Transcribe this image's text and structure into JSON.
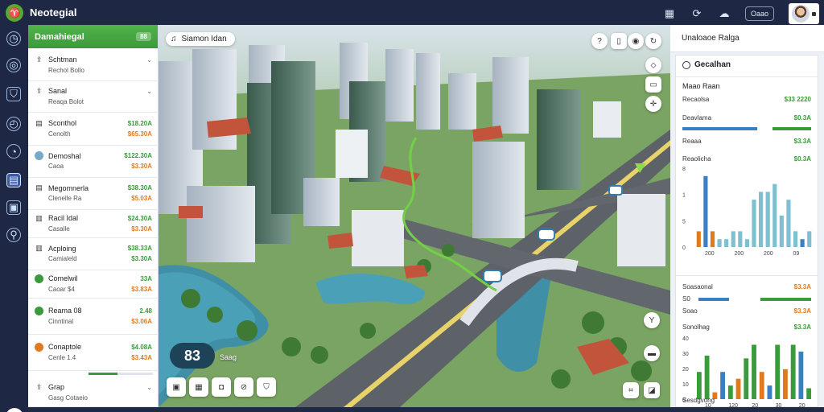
{
  "app": {
    "title": "Neotegial",
    "logo_glyph": "♈"
  },
  "topbar": {
    "icons": [
      "clipboard-icon",
      "refresh-icon",
      "cloud-icon"
    ],
    "pill_label": "Oaao"
  },
  "rail": {
    "items": [
      "clock-icon",
      "globe-icon",
      "shield-icon",
      "timer-icon",
      "gauge-icon",
      "chart-icon",
      "images-icon",
      "search-icon"
    ],
    "bottom_icon": "leaf-icon"
  },
  "left_panel": {
    "title": "Damahiegal",
    "badge": "88",
    "rows": [
      {
        "icon": "upload-icon",
        "name": "Schtman",
        "sub": "Rechol Bollo",
        "value": "",
        "value_color": ""
      },
      {
        "icon": "upload-icon",
        "name": "Sanal",
        "sub": "Reaqa Bolot",
        "value": "",
        "value_color": ""
      },
      {
        "icon": "list-icon",
        "name": "Sconthol",
        "sub": "Cenolth",
        "value": "$18.20A",
        "sub_value": "$65.30A",
        "value_color": "green",
        "sub_color": "orange"
      },
      {
        "icon": "avatar",
        "name": "Demoshal",
        "sub": "Caoa",
        "value": "$122.30A",
        "sub_value": "$3.30A",
        "value_color": "green",
        "sub_color": "orange"
      },
      {
        "icon": "list-icon",
        "name": "Megomnerla",
        "sub": "Clenelle Ra",
        "value": "$38.30A",
        "sub_value": "$5.03A",
        "value_color": "green",
        "sub_color": "orange"
      },
      {
        "icon": "doc-icon",
        "name": "Racil Idal",
        "sub": "Casalle",
        "value": "$24.30A",
        "sub_value": "$3.30A",
        "value_color": "green",
        "sub_color": "orange"
      },
      {
        "icon": "doc-icon",
        "name": "Acploing",
        "sub": "Camialeld",
        "value": "$38.33A",
        "sub_value": "$3.30A",
        "value_color": "green",
        "sub_color": "green"
      },
      {
        "icon": "green-dot",
        "name": "Comelwil",
        "sub": "Caoar $4",
        "value": "33A",
        "sub_value": "$3.83A",
        "value_color": "green",
        "sub_color": "orange"
      },
      {
        "icon": "green-dot",
        "name": "Reama 08",
        "sub": "Cinntinal",
        "value": "2.48",
        "sub_value": "$3.06A",
        "value_color": "green",
        "sub_color": "orange"
      },
      {
        "icon": "orange-dot",
        "name": "Conaptole",
        "sub": "Cenle 1.4",
        "value": "$4.08A",
        "sub_value": "$3.43A",
        "value_color": "green",
        "sub_color": "orange"
      },
      {
        "icon": "upload-icon",
        "name": "Grap",
        "sub": "Gasg Cotaeio",
        "value": "",
        "sub_value": "",
        "value_color": "",
        "sub_color": ""
      }
    ],
    "progress_fraction": 0.45
  },
  "map": {
    "location_label": "Siamon Idan",
    "location_icon": "pin-icon",
    "stat_value": "83",
    "stat_caption": "Saag",
    "tools": [
      "layers-icon",
      "grid-icon",
      "camera-icon",
      "compass-icon",
      "shield-icon"
    ]
  },
  "right_panel": {
    "header": "Unaloaoe Ralga",
    "card_title": "Gecalhan",
    "section_title": "Maao Raan",
    "lines": [
      {
        "label": "Recaolsa",
        "value": "$33 2220",
        "color": "green"
      },
      {
        "label": "Deavlama",
        "value": "$0.3A",
        "color": "green"
      },
      {
        "label": "Reaaa",
        "value": "$3.3A",
        "color": "green"
      },
      {
        "label": "Reaolicha",
        "value": "$0.3A",
        "color": "green"
      }
    ],
    "bar_rows": [
      {
        "label": "Soasaonal",
        "value": "$3.3A",
        "color": "orange"
      },
      {
        "label": "S0",
        "value": "",
        "color": ""
      },
      {
        "label": "Soao",
        "value": "$3.3A",
        "color": "orange"
      },
      {
        "label": "Sonolhag",
        "value": "$3.3A",
        "color": "green"
      }
    ],
    "footer": "Sesdgvong",
    "chart1": {
      "type": "bar",
      "ytick_labels": [
        "8",
        "1",
        "5",
        "0"
      ],
      "xtick_labels": [
        "200",
        "200",
        "200",
        "09"
      ],
      "values": [
        2,
        9,
        2,
        1,
        1,
        2,
        2,
        1,
        6,
        7,
        7,
        8,
        4,
        6,
        2,
        1,
        2
      ],
      "colors": [
        "#e07a1e",
        "#3a7fc4",
        "#e07a1e",
        "#7fc0d0",
        "#7fc0d0",
        "#7fc0d0",
        "#7fc0d0",
        "#7fc0d0",
        "#7fc0d0",
        "#7fc0d0",
        "#7fc0d0",
        "#7fc0d0",
        "#7fc0d0",
        "#7fc0d0",
        "#7fc0d0",
        "#3a7fc4",
        "#7fc0d0"
      ],
      "ylim": [
        0,
        10
      ]
    },
    "chart2": {
      "type": "bar",
      "ytick_labels": [
        "40",
        "30",
        "20",
        "10",
        "0"
      ],
      "xtick_labels": [
        "10",
        "120",
        "20",
        "30",
        "20"
      ],
      "values": [
        20,
        32,
        5,
        20,
        10,
        15,
        30,
        40,
        20,
        10,
        40,
        22,
        40,
        35,
        8
      ],
      "colors": [
        "#3a9b3a",
        "#3a9b3a",
        "#e07a1e",
        "#3a7fc4",
        "#3a9b3a",
        "#e07a1e",
        "#3a9b3a",
        "#3a9b3a",
        "#e07a1e",
        "#3a7fc4",
        "#3a9b3a",
        "#e07a1e",
        "#3a9b3a",
        "#3a7fc4",
        "#3a9b3a"
      ],
      "ylim": [
        0,
        45
      ]
    }
  }
}
